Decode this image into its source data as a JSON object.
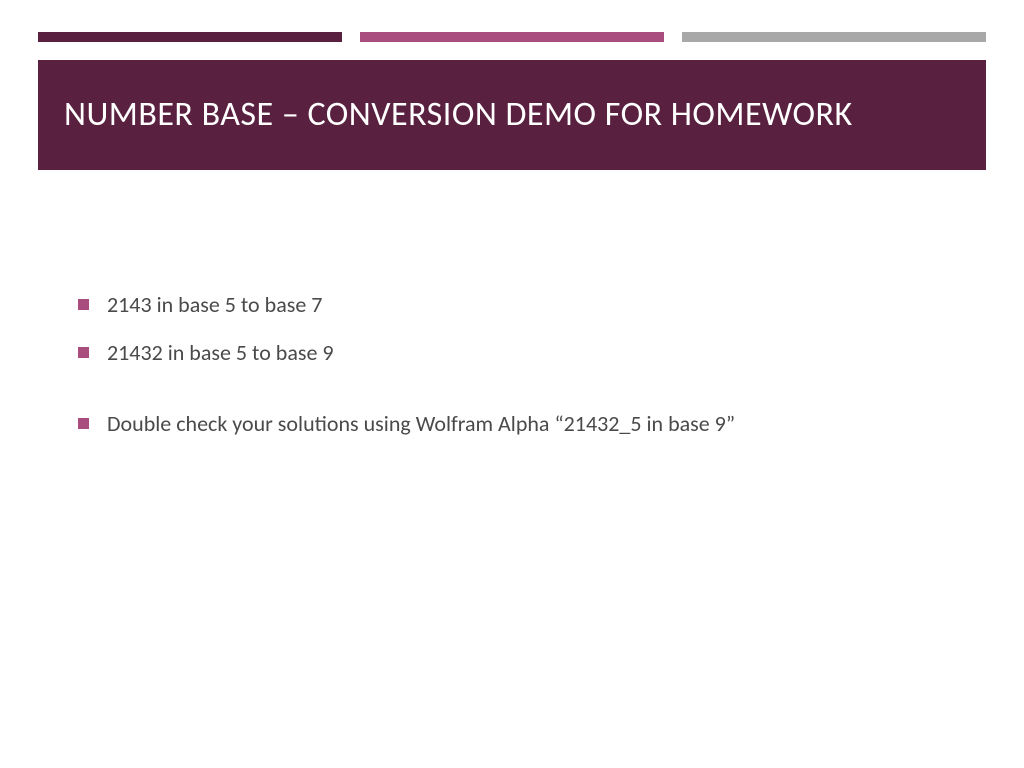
{
  "colors": {
    "bar1": "#5a2040",
    "bar2": "#a94d7f",
    "bar3": "#a8a8a8",
    "titleBg": "#5a2040",
    "titleText": "#ffffff",
    "bodyText": "#4a4a4a",
    "bulletMarker": "#a94d7f"
  },
  "title": "NUMBER BASE – CONVERSION DEMO FOR HOMEWORK",
  "bullets": [
    {
      "text": "2143 in base 5 to base 7",
      "spaced": false
    },
    {
      "text": "21432 in base 5 to base 9",
      "spaced": false
    },
    {
      "text": "Double check your solutions using Wolfram Alpha “21432_5 in base 9”",
      "spaced": true
    }
  ]
}
